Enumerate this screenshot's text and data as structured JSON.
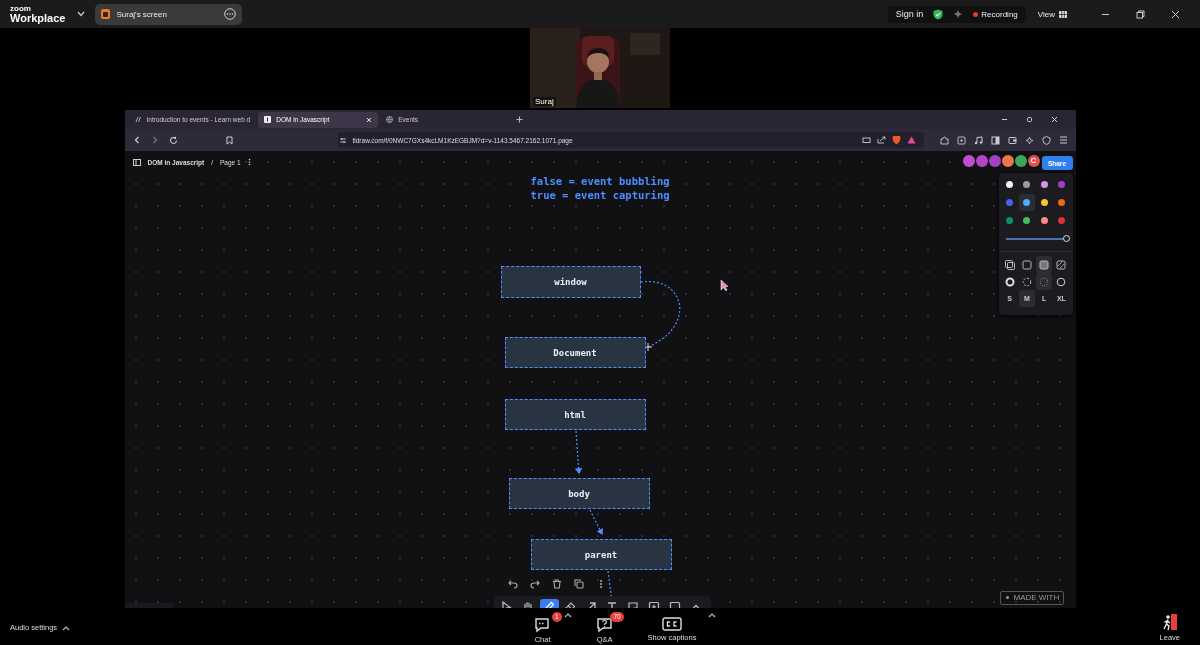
{
  "zoom_bar": {
    "logo_top": "zoom",
    "logo_bottom": "Workplace",
    "share_label": "Suraj's screen",
    "sign_in": "Sign in",
    "recording": "Recording",
    "view": "View"
  },
  "video": {
    "name": "Suraj",
    "kind": "picture"
  },
  "browser": {
    "tabs": [
      {
        "label": "Introduction to events - Learn web d",
        "selected": false
      },
      {
        "label": "DOM in Javascript",
        "selected": true
      },
      {
        "label": "Events",
        "selected": false
      }
    ],
    "url": "tldraw.com/f/0NWC7GXs4kcLM1KzEGBJM?d=v-1143.5467.2162.1071.page"
  },
  "tldraw": {
    "document": "DOM in Javascript",
    "separator": "/",
    "page": "Page 1",
    "share": "Share",
    "collaborators": [
      {
        "color": "#c04fd0"
      },
      {
        "color": "#b146c2"
      },
      {
        "color": "#a43fc7"
      },
      {
        "color": "#e8784a"
      },
      {
        "color": "#3aa55d"
      },
      {
        "color": "#e05050",
        "initial": "C"
      }
    ],
    "note_lines": [
      "false = event bubbling",
      "true = event capturing"
    ],
    "nodes": [
      {
        "label": "window"
      },
      {
        "label": "Document"
      },
      {
        "label": "html"
      },
      {
        "label": "body"
      },
      {
        "label": "parent"
      }
    ],
    "style_panel": {
      "colors": [
        {
          "color": "#f1f1f1",
          "selected": false
        },
        {
          "color": "#9a9aa2",
          "selected": false
        },
        {
          "color": "#d794e8",
          "selected": false
        },
        {
          "color": "#a43fc7",
          "selected": false
        },
        {
          "color": "#4263eb",
          "selected": false
        },
        {
          "color": "#4dabf7",
          "selected": true
        },
        {
          "color": "#ffc034",
          "selected": false
        },
        {
          "color": "#f76707",
          "selected": false
        },
        {
          "color": "#099268",
          "selected": false
        },
        {
          "color": "#40c057",
          "selected": false
        },
        {
          "color": "#ff8787",
          "selected": false
        },
        {
          "color": "#e03131",
          "selected": false
        }
      ],
      "opacity": {
        "level": 1
      },
      "fills": [
        {
          "kind": "none",
          "selected": false
        },
        {
          "kind": "semi",
          "selected": false
        },
        {
          "kind": "solid",
          "selected": true
        },
        {
          "kind": "pattern",
          "selected": false
        }
      ],
      "dashes": [
        {
          "kind": "draw",
          "selected": false
        },
        {
          "kind": "dashed",
          "selected": false
        },
        {
          "kind": "dotted",
          "selected": true
        },
        {
          "kind": "solid",
          "selected": false
        }
      ],
      "sizes": [
        {
          "label": "S",
          "selected": false
        },
        {
          "label": "M",
          "selected": true
        },
        {
          "label": "L",
          "selected": false
        },
        {
          "label": "XL",
          "selected": false
        }
      ]
    },
    "quick_actions": [
      {
        "kind": "undo"
      },
      {
        "kind": "redo"
      },
      {
        "kind": "delete"
      },
      {
        "kind": "duplicate"
      },
      {
        "kind": "more"
      }
    ],
    "tools": [
      {
        "kind": "select",
        "selected": false
      },
      {
        "kind": "hand",
        "selected": false
      },
      {
        "kind": "draw",
        "selected": true
      },
      {
        "kind": "eraser",
        "selected": false
      },
      {
        "kind": "arrow",
        "selected": false
      },
      {
        "kind": "text",
        "selected": false
      },
      {
        "kind": "note",
        "selected": false
      },
      {
        "kind": "asset",
        "selected": false
      },
      {
        "kind": "rectangle",
        "selected": false
      },
      {
        "kind": "expand",
        "selected": false
      }
    ],
    "made_with": "MADE WITH"
  },
  "controls": {
    "audio": "Audio settings",
    "items": [
      {
        "kind": "chat",
        "label": "Chat",
        "badge": "1"
      },
      {
        "kind": "qa",
        "label": "Q&A",
        "badge": "70"
      },
      {
        "kind": "captions",
        "label": "Show captions"
      }
    ],
    "leave": "Leave"
  }
}
